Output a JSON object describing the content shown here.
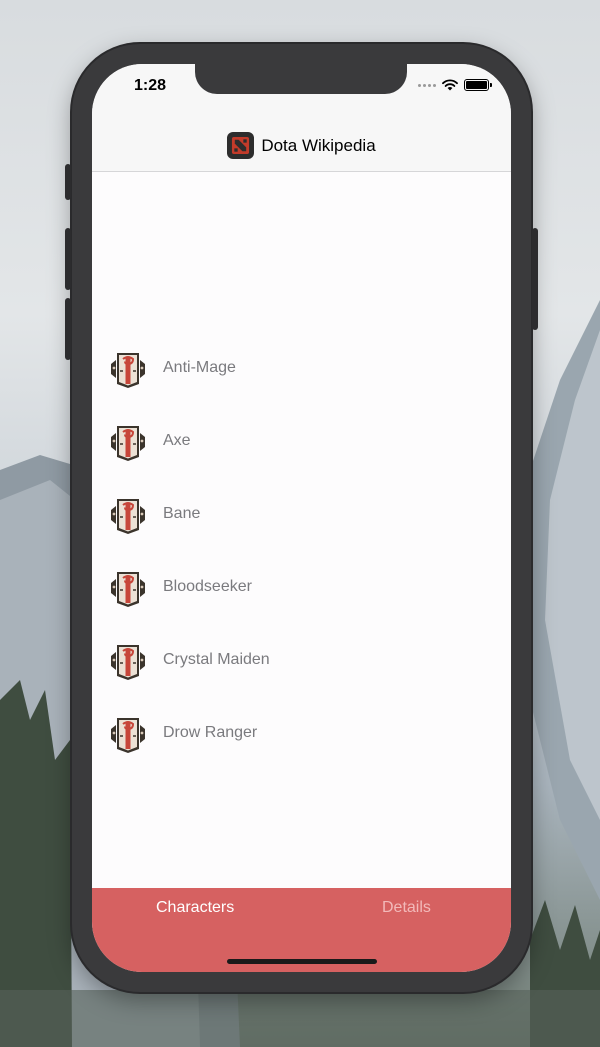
{
  "status_bar": {
    "time": "1:28"
  },
  "nav": {
    "title": "Dota Wikipedia",
    "icon": "dota-logo-icon"
  },
  "heroes": [
    {
      "name": "Anti-Mage",
      "icon": "hero-placeholder-icon"
    },
    {
      "name": "Axe",
      "icon": "hero-placeholder-icon"
    },
    {
      "name": "Bane",
      "icon": "hero-placeholder-icon"
    },
    {
      "name": "Bloodseeker",
      "icon": "hero-placeholder-icon"
    },
    {
      "name": "Crystal Maiden",
      "icon": "hero-placeholder-icon"
    },
    {
      "name": "Drow Ranger",
      "icon": "hero-placeholder-icon"
    }
  ],
  "tabs": [
    {
      "label": "Characters",
      "active": true
    },
    {
      "label": "Details",
      "active": false
    }
  ],
  "colors": {
    "tab_bar": "#d66161",
    "tab_active": "#ffffff",
    "tab_inactive": "#f2b9b9",
    "hero_text": "#7a7a7e"
  }
}
